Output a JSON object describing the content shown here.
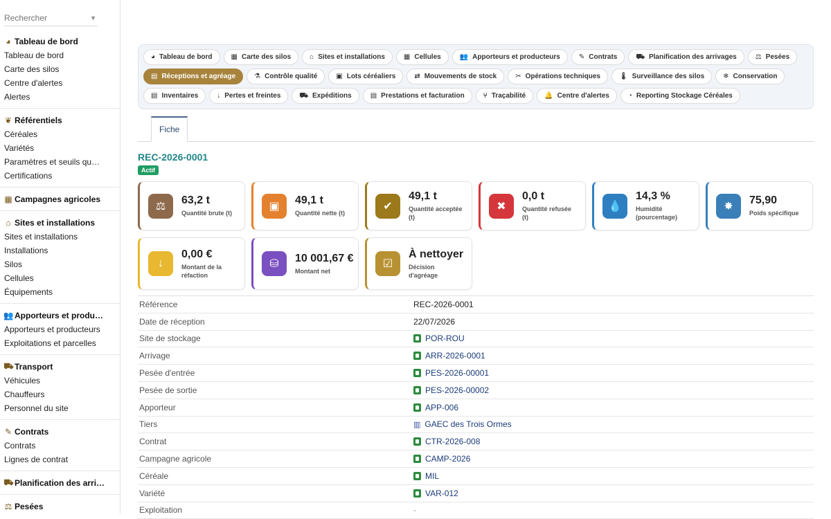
{
  "search": {
    "placeholder": "Rechercher"
  },
  "sidebar": {
    "groups": [
      {
        "icon": "dashboard-icon",
        "title": "Tableau de bord",
        "items": [
          "Tableau de bord",
          "Carte des silos",
          "Centre d'alertes",
          "Alertes"
        ]
      },
      {
        "icon": "sprout-icon",
        "title": "Référentiels",
        "items": [
          "Céréales",
          "Variétés",
          "Paramètres et seuils qual…",
          "Certifications"
        ]
      },
      {
        "icon": "calendar-icon",
        "title": "Campagnes agricoles",
        "items": []
      },
      {
        "icon": "warehouse-icon",
        "title": "Sites et installations",
        "items": [
          "Sites et installations",
          "Installations",
          "Silos",
          "Cellules",
          "Équipements"
        ]
      },
      {
        "icon": "users-icon",
        "title": "Apporteurs et produ…",
        "items": [
          "Apporteurs et producteurs",
          "Exploitations et parcelles"
        ]
      },
      {
        "icon": "truck-icon",
        "title": "Transport",
        "items": [
          "Véhicules",
          "Chauffeurs",
          "Personnel du site"
        ]
      },
      {
        "icon": "contract-icon",
        "title": "Contrats",
        "items": [
          "Contrats",
          "Lignes de contrat"
        ]
      },
      {
        "icon": "truck-loading-icon",
        "title": "Planification des arri…",
        "items": []
      },
      {
        "icon": "scale-icon",
        "title": "Pesées",
        "items": []
      }
    ]
  },
  "tabs": [
    {
      "icon": "dashboard-icon",
      "glyph": "◕",
      "label": "Tableau de bord",
      "active": false
    },
    {
      "icon": "grid-icon",
      "glyph": "▦",
      "label": "Carte des silos",
      "active": false
    },
    {
      "icon": "warehouse-icon",
      "glyph": "⌂",
      "label": "Sites et installations",
      "active": false
    },
    {
      "icon": "grid-icon",
      "glyph": "▦",
      "label": "Cellules",
      "active": false
    },
    {
      "icon": "users-icon",
      "glyph": "👥",
      "label": "Apporteurs et producteurs",
      "active": false
    },
    {
      "icon": "contract-icon",
      "glyph": "✎",
      "label": "Contrats",
      "active": false
    },
    {
      "icon": "truck-loading-icon",
      "glyph": "⛟",
      "label": "Planification des arrivages",
      "active": false
    },
    {
      "icon": "scale-icon",
      "glyph": "⚖",
      "label": "Pesées",
      "active": false
    },
    {
      "icon": "clipboard-icon",
      "glyph": "▤",
      "label": "Réceptions et agréage",
      "active": true
    },
    {
      "icon": "flask-icon",
      "glyph": "⚗",
      "label": "Contrôle qualité",
      "active": false
    },
    {
      "icon": "lots-icon",
      "glyph": "▣",
      "label": "Lots céréaliers",
      "active": false
    },
    {
      "icon": "exchange-icon",
      "glyph": "⇄",
      "label": "Mouvements de stock",
      "active": false
    },
    {
      "icon": "tools-icon",
      "glyph": "✂",
      "label": "Opérations techniques",
      "active": false
    },
    {
      "icon": "thermometer-icon",
      "glyph": "🌡",
      "label": "Surveillance des silos",
      "active": false
    },
    {
      "icon": "conservation-icon",
      "glyph": "❄",
      "label": "Conservation",
      "active": false
    },
    {
      "icon": "inventory-icon",
      "glyph": "▤",
      "label": "Inventaires",
      "active": false
    },
    {
      "icon": "arrow-down-icon",
      "glyph": "↓",
      "label": "Pertes et freintes",
      "active": false
    },
    {
      "icon": "shipping-icon",
      "glyph": "⛟",
      "label": "Expéditions",
      "active": false
    },
    {
      "icon": "invoice-icon",
      "glyph": "▤",
      "label": "Prestations et facturation",
      "active": false
    },
    {
      "icon": "tree-icon",
      "glyph": "⑂",
      "label": "Traçabilité",
      "active": false
    },
    {
      "icon": "bell-icon",
      "glyph": "🔔",
      "label": "Centre d'alertes",
      "active": false
    },
    {
      "icon": "chart-pie-icon",
      "glyph": "◔",
      "label": "Reporting Stockage Céréales",
      "active": false
    }
  ],
  "fiche_tab": "Fiche",
  "record": {
    "title": "REC-2026-0001",
    "status": "Actif"
  },
  "cards": [
    {
      "icon": "scale-icon",
      "glyph": "⚖",
      "value": "63,2 t",
      "label": "Quantité brute (t)",
      "color": "#8e6a4c"
    },
    {
      "icon": "boxes-icon",
      "glyph": "▣",
      "value": "49,1 t",
      "label": "Quantité nette (t)",
      "color": "#e4812e"
    },
    {
      "icon": "check-circle-icon",
      "glyph": "✔",
      "value": "49,1 t",
      "label": "Quantité acceptée (t)",
      "color": "#9c7a1c"
    },
    {
      "icon": "x-circle-icon",
      "glyph": "✖",
      "value": "0,0 t",
      "label": "Quantité refusée (t)",
      "color": "#d4363c"
    },
    {
      "icon": "droplet-icon",
      "glyph": "💧",
      "value": "14,3 %",
      "label": "Humidité (pourcentage)",
      "color": "#2e7fc0"
    },
    {
      "icon": "certificate-icon",
      "glyph": "✸",
      "value": "75,90",
      "label": "Poids spécifique",
      "color": "#3a7fb8"
    },
    {
      "icon": "arrow-down-icon",
      "glyph": "↓",
      "value": "0,00 €",
      "label": "Montant de la réfaction",
      "color": "#e8b830"
    },
    {
      "icon": "coins-icon",
      "glyph": "⛁",
      "value": "10 001,67 €",
      "label": "Montant net",
      "color": "#7a4fbf"
    },
    {
      "icon": "clipboard-check-icon",
      "glyph": "☑",
      "value": "À nettoyer",
      "label": "Décision d'agréage",
      "color": "#b89232"
    }
  ],
  "details": [
    {
      "label": "Référence",
      "value": "REC-2026-0001",
      "link": false,
      "kind": "text"
    },
    {
      "label": "Date de réception",
      "value": "22/07/2026",
      "link": false,
      "kind": "text"
    },
    {
      "label": "Site de stockage",
      "value": "POR-ROU",
      "link": true,
      "kind": "record"
    },
    {
      "label": "Arrivage",
      "value": "ARR-2026-0001",
      "link": true,
      "kind": "record"
    },
    {
      "label": "Pesée d'entrée",
      "value": "PES-2026-00001",
      "link": true,
      "kind": "record"
    },
    {
      "label": "Pesée de sortie",
      "value": "PES-2026-00002",
      "link": true,
      "kind": "record"
    },
    {
      "label": "Apporteur",
      "value": "APP-006",
      "link": true,
      "kind": "record"
    },
    {
      "label": "Tiers",
      "value": "GAEC des Trois Ormes",
      "link": true,
      "kind": "building"
    },
    {
      "label": "Contrat",
      "value": "CTR-2026-008",
      "link": true,
      "kind": "record"
    },
    {
      "label": "Campagne agricole",
      "value": "CAMP-2026",
      "link": true,
      "kind": "record"
    },
    {
      "label": "Céréale",
      "value": "MIL",
      "link": true,
      "kind": "record"
    },
    {
      "label": "Variété",
      "value": "VAR-012",
      "link": true,
      "kind": "record"
    },
    {
      "label": "Exploitation",
      "value": "-",
      "link": false,
      "kind": "empty"
    }
  ]
}
